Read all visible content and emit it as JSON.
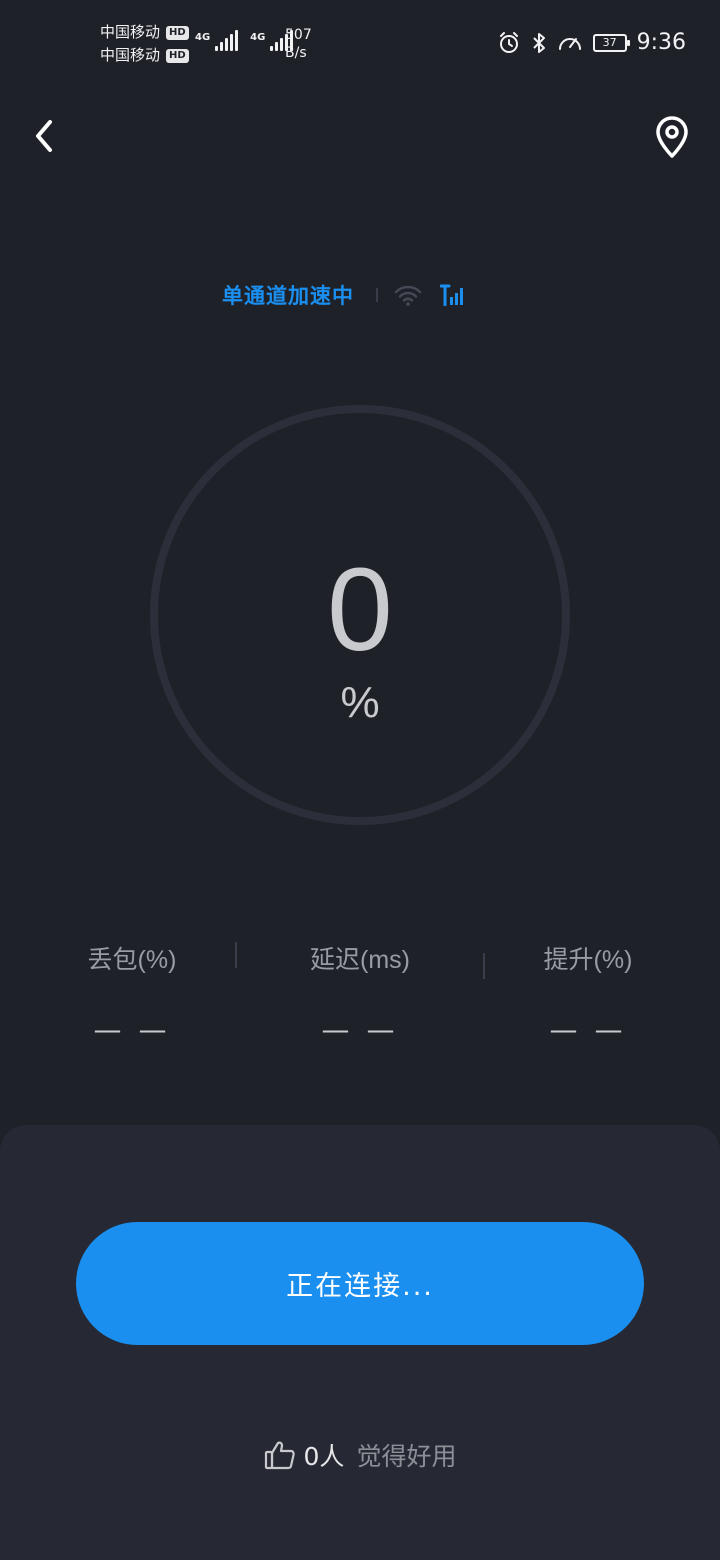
{
  "status_bar": {
    "carrier_1": "中国移动",
    "carrier_2": "中国移动",
    "hd_badge": "HD",
    "network_type": "4G",
    "net_speed_value": "507",
    "net_speed_unit": "B/s",
    "battery_level": "37",
    "time": "9:36"
  },
  "top_bar": {
    "back_icon": "chevron-left-icon",
    "location_icon": "location-pin-icon"
  },
  "mode": {
    "label": "单通道加速中",
    "wifi_icon": "wifi-icon",
    "cellular_icon": "cellular-signal-icon",
    "accent_color": "#1a8fef"
  },
  "gauge": {
    "value": "0",
    "unit": "%"
  },
  "stats": [
    {
      "label": "丢包(%)",
      "value": "— —"
    },
    {
      "label": "延迟(ms)",
      "value": "— —"
    },
    {
      "label": "提升(%)",
      "value": "— —"
    }
  ],
  "action": {
    "connect_label": "正在连接...",
    "button_color": "#1a8fef"
  },
  "likes": {
    "icon": "thumbs-up-icon",
    "count": "0人",
    "text": "觉得好用"
  }
}
